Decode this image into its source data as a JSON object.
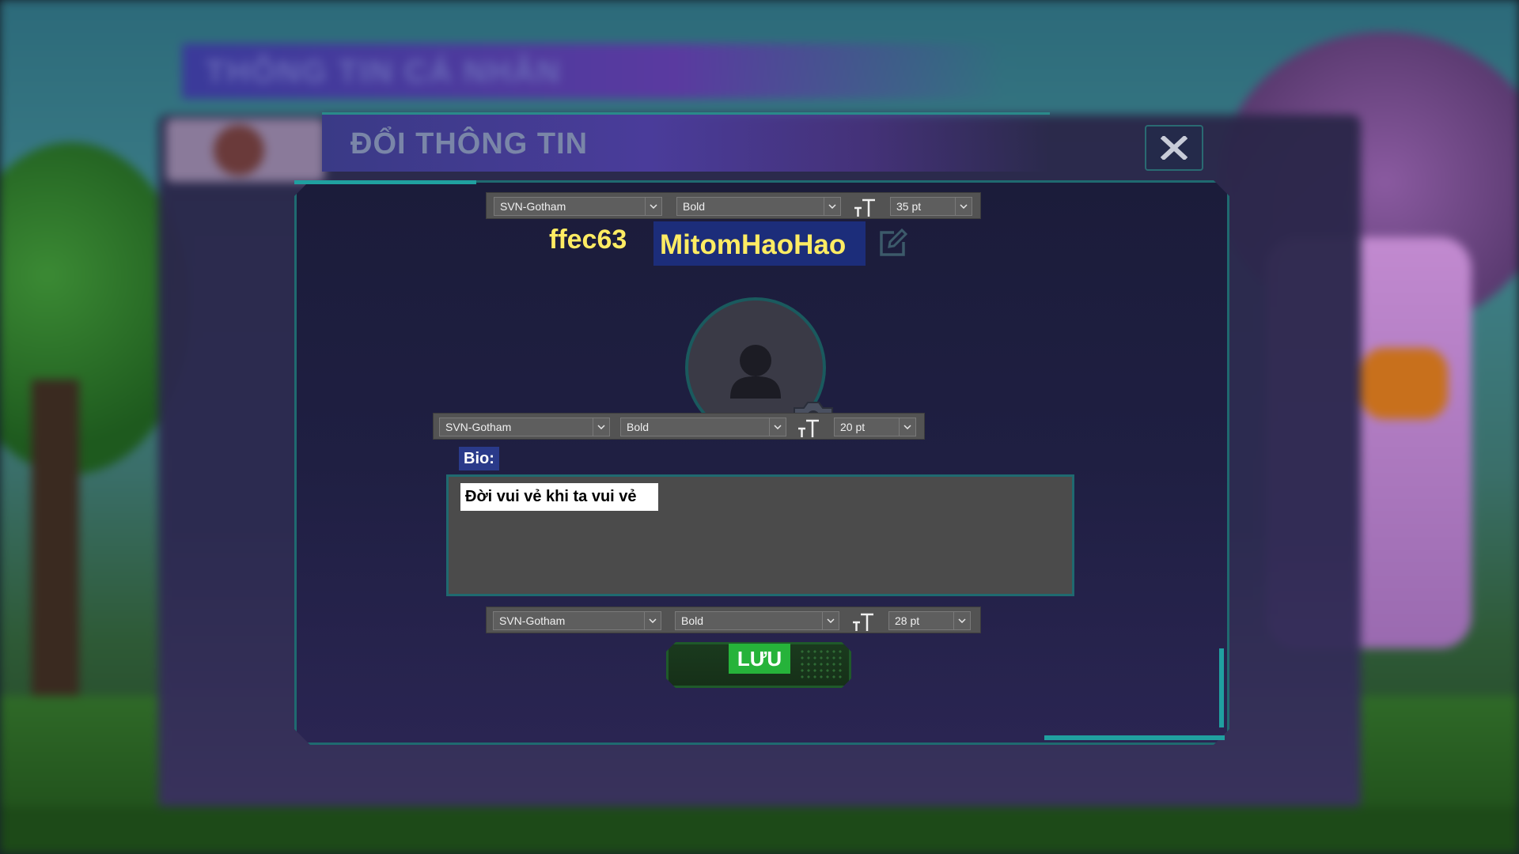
{
  "background": {
    "panel_title": "THÔNG TIN CÁ NHÂN"
  },
  "modal": {
    "title": "ĐỔI THÔNG TIN",
    "close_icon": "close-x-icon"
  },
  "name_toolbar": {
    "font": "SVN-Gotham",
    "weight": "Bold",
    "size": "35 pt"
  },
  "name_row": {
    "uid": "ffec63",
    "display_name": "MitomHaoHao",
    "edit_icon": "edit-pencil-icon"
  },
  "avatar": {
    "icon": "user-silhouette-icon",
    "camera_icon": "camera-icon"
  },
  "bio_toolbar": {
    "font": "SVN-Gotham",
    "weight": "Bold",
    "size": "20 pt"
  },
  "bio": {
    "label": "Bio:",
    "text": "Đời vui vẻ khi ta vui vẻ"
  },
  "save_toolbar": {
    "font": "SVN-Gotham",
    "weight": "Bold",
    "size": "28 pt"
  },
  "save_button": {
    "label": "LƯU"
  },
  "colors": {
    "highlight_yellow": "#ffec63",
    "name_bg": "#1c2d7a",
    "save_green": "#26b33a",
    "frame_teal": "#1f6a70"
  }
}
